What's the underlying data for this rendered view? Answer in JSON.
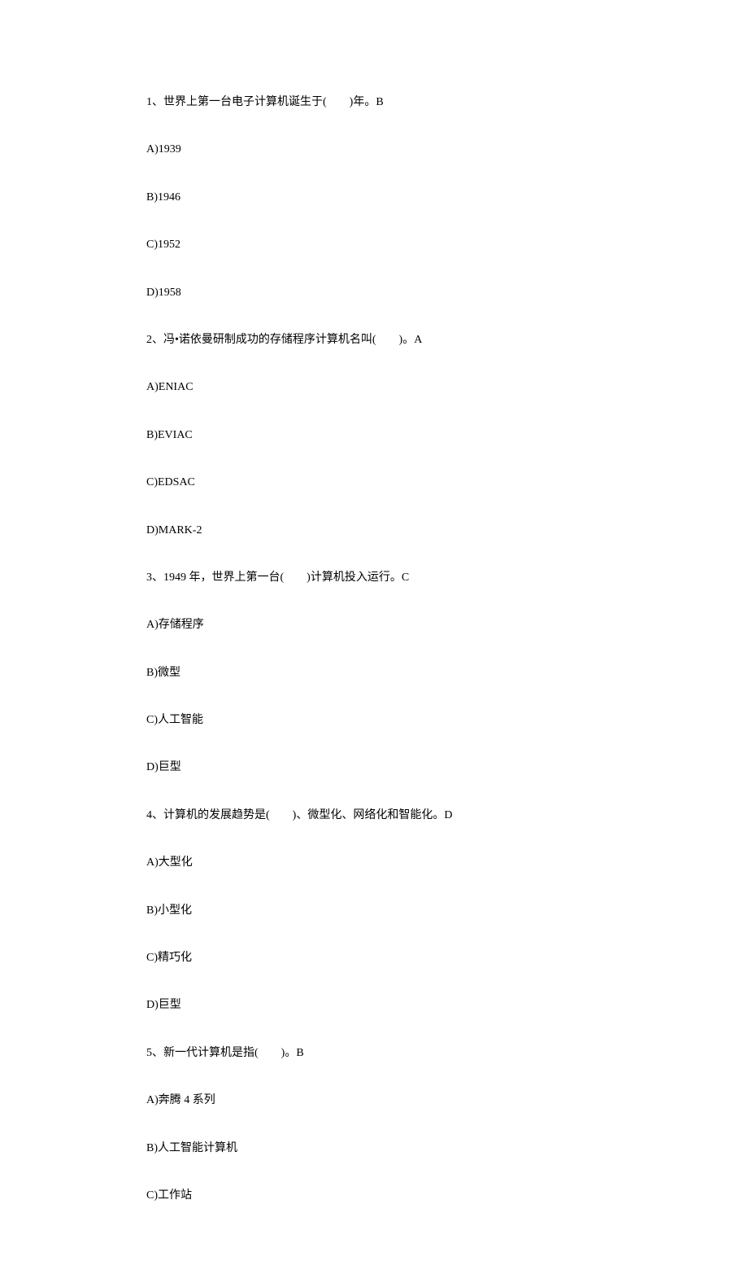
{
  "questions": [
    {
      "stem": "1、世界上第一台电子计算机诞生于(　　)年。B",
      "options": [
        "A)1939",
        "B)1946",
        "C)1952",
        "D)1958"
      ]
    },
    {
      "stem": "2、冯•诺依曼研制成功的存储程序计算机名叫(　　)。A",
      "options": [
        "A)ENIAC",
        "B)EVIAC",
        "C)EDSAC",
        "D)MARK-2"
      ]
    },
    {
      "stem": "3、1949 年，世界上第一台(　　)计算机投入运行。C",
      "options": [
        "A)存储程序",
        "B)微型",
        "C)人工智能",
        "D)巨型"
      ]
    },
    {
      "stem": "4、计算机的发展趋势是(　　)、微型化、网络化和智能化。D",
      "options": [
        "A)大型化",
        "B)小型化",
        "C)精巧化",
        "D)巨型"
      ]
    },
    {
      "stem": "5、新一代计算机是指(　　)。B",
      "options": [
        "A)奔腾 4 系列",
        "B)人工智能计算机",
        "C)工作站"
      ]
    }
  ]
}
